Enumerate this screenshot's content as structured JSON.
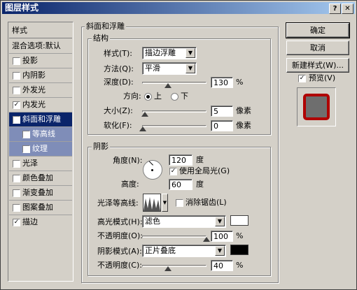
{
  "window": {
    "title": "图层样式",
    "help": "?",
    "close": "✕"
  },
  "sidebar": {
    "header": "样式",
    "blend_options": "混合选项:默认",
    "items": [
      {
        "label": "投影",
        "checked": false
      },
      {
        "label": "内阴影",
        "checked": false
      },
      {
        "label": "外发光",
        "checked": false
      },
      {
        "label": "内发光",
        "checked": true
      },
      {
        "label": "斜面和浮雕",
        "checked": true
      },
      {
        "label": "等高线",
        "checked": true
      },
      {
        "label": "纹理",
        "checked": false
      },
      {
        "label": "光泽",
        "checked": false
      },
      {
        "label": "颜色叠加",
        "checked": false
      },
      {
        "label": "渐变叠加",
        "checked": false
      },
      {
        "label": "图案叠加",
        "checked": false
      },
      {
        "label": "描边",
        "checked": true
      }
    ],
    "check_mark": "✓"
  },
  "bevel": {
    "title": "斜面和浮雕",
    "structure": {
      "title": "结构",
      "style_label": "样式(T):",
      "style_value": "描边浮雕",
      "technique_label": "方法(Q):",
      "technique_value": "平滑",
      "depth_label": "深度(D):",
      "depth_value": "130",
      "depth_unit": "%",
      "direction_label": "方向:",
      "direction_up": "上",
      "direction_down": "下",
      "size_label": "大小(Z):",
      "size_value": "5",
      "size_unit": "像素",
      "soften_label": "软化(F):",
      "soften_value": "0",
      "soften_unit": "像素"
    },
    "shading": {
      "title": "阴影",
      "angle_label": "角度(N):",
      "angle_value": "120",
      "angle_unit": "度",
      "global_light_label": "使用全局光(G)",
      "altitude_label": "高度:",
      "altitude_value": "60",
      "altitude_unit": "度",
      "gloss_label": "光泽等高线:",
      "antialias_label": "消除锯齿(L)",
      "highlight_mode_label": "高光模式(H):",
      "highlight_mode_value": "滤色",
      "highlight_opacity_label": "不透明度(O):",
      "highlight_opacity_value": "100",
      "highlight_opacity_unit": "%",
      "highlight_color": "#ffffff",
      "shadow_mode_label": "阴影模式(A):",
      "shadow_mode_value": "正片叠底",
      "shadow_opacity_label": "不透明度(C):",
      "shadow_opacity_value": "40",
      "shadow_opacity_unit": "%",
      "shadow_color": "#000000"
    }
  },
  "buttons": {
    "ok": "确定",
    "cancel": "取消",
    "new_style": "新建样式(W)...",
    "preview_label": "预览(V)"
  },
  "colors": {
    "preview_border": "#b00000",
    "preview_fill": "#6e6e6e"
  }
}
